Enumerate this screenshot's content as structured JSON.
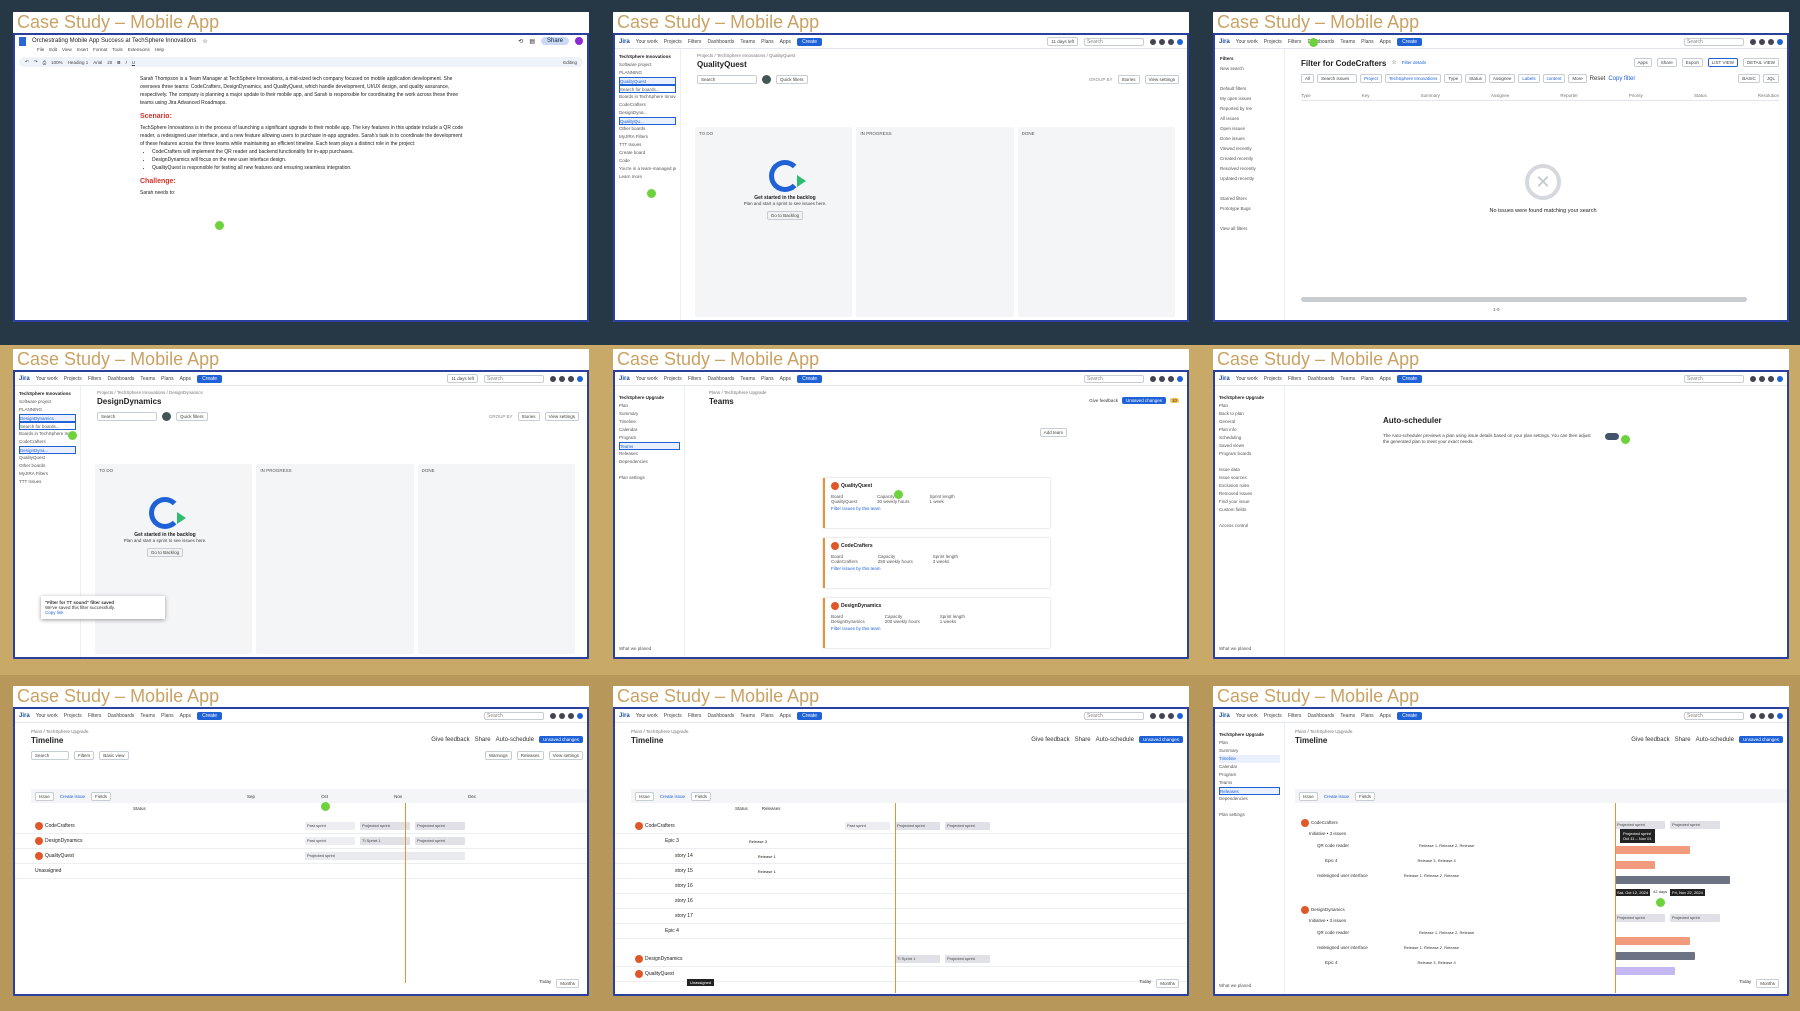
{
  "caption": "Case Study – Mobile App",
  "jira_nav": {
    "logo": "Jira",
    "items": [
      "Your work",
      "Projects",
      "Filters",
      "Dashboards",
      "Teams",
      "Plans",
      "Apps"
    ],
    "create": "Create",
    "search": "Search"
  },
  "doc": {
    "title": "Orchestrating Mobile App Success at TechSphere Innovations",
    "menu": [
      "File",
      "Edit",
      "View",
      "Insert",
      "Format",
      "Tools",
      "Extensions",
      "Help"
    ],
    "toolbar": [
      "100%",
      "Heading 1",
      "Arial",
      "20",
      "Editing"
    ],
    "share": "Share",
    "intro": "Sarah Thompson is a Team Manager at TechSphere Innovations, a mid-sized tech company focused on mobile application development. She oversees three teams: CodeCrafters, DesignDynamics, and QualityQuest, which handle development, UI/UX design, and quality assurance, respectively. The company is planning a major update to their mobile app, and Sarah is responsible for coordinating the work across these three teams using Jira Advanced Roadmaps.",
    "scenario_title": "Scenario:",
    "scenario": "TechSphere Innovations is in the process of launching a significant upgrade to their mobile app. The key features in this update include a QR code reader, a redesigned user interface, and a new feature allowing users to purchase in-app upgrades. Sarah's task is to coordinate the development of these features across the three teams while maintaining an efficient timeline. Each team plays a distinct role in the project:",
    "bullets": [
      "CodeCrafters will implement the QR reader and backend functionality for in-app purchases.",
      "DesignDynamics will focus on the new user interface design.",
      "QualityQuest is responsible for testing all new features and ensuring seamless integration."
    ],
    "challenge_title": "Challenge:",
    "challenge": "Sarah needs to:"
  },
  "board_qq": {
    "project": "TechSphere Innovations",
    "project_sub": "Software project",
    "planning": "PLANNING",
    "selected": "QualityQuest",
    "selected_sub": "Board",
    "search_boards": "Search for boards...",
    "boards_in": "Boards in TechSphere Innovations",
    "boards": [
      "CodeCrafters",
      "DesignDyna...",
      "QualityQu..."
    ],
    "other": "Other boards",
    "view_all": "View all",
    "other_boards": [
      "MyJIRA Filters",
      "TTT Issues"
    ],
    "create_board": "Create board",
    "code": "Code",
    "team_managed": "You're in a team-managed project",
    "learn": "Learn more",
    "crumbs": "Projects  /  TechSphere Innovations  /  QualityQuest",
    "title": "QualityQuest",
    "search": "Search",
    "quick": "Quick filters",
    "group": "GROUP BY",
    "stories": "Stories",
    "view_settings": "View settings",
    "start_standup": "Start stand-up",
    "days_left": "11 days left",
    "cols": [
      "TO DO",
      "IN PROGRESS",
      "DONE"
    ],
    "empty_title": "Get started in the backlog",
    "empty_text": "Plan and start a sprint to see issues here.",
    "go": "Go to Backlog"
  },
  "filter": {
    "side_title": "Filters",
    "side": [
      "New search",
      "",
      "Default filters",
      "My open issues",
      "Reported by me",
      "All issues",
      "Open issues",
      "Done issues",
      "Viewed recently",
      "Created recently",
      "Resolved recently",
      "Updated recently",
      "",
      "Starred filters",
      "Prototype Bugs",
      "",
      "View all filters"
    ],
    "title": "Filter for CodeCrafters",
    "filter_details": "Filter details",
    "apps": "Apps",
    "share": "Share",
    "export": "Export",
    "list_view": "LIST VIEW",
    "detail_view": "DETAIL VIEW",
    "all": "All",
    "search_issues": "Search issues",
    "chips": [
      "Project",
      "TechSphere Innovations",
      "Type",
      "Status",
      "Assignee",
      "Labels",
      "content",
      "More"
    ],
    "reset": "Reset",
    "copy": "Copy filter",
    "basic": "BASIC",
    "jql": "JQL",
    "cols": [
      "Type",
      "Key",
      "Summary",
      "Assignee",
      "Reporter",
      "Priority",
      "Status",
      "Resolution"
    ],
    "empty": "No issues were found matching your search",
    "pager": "1-0"
  },
  "board_dd": {
    "title": "DesignDynamics",
    "crumbs": "Projects  /  TechSphere Innovations  /  DesignDynamics",
    "selected": "DesignDynamics",
    "boards": [
      "CodeCrafters",
      "DesignDyna...",
      "QualityQuest"
    ],
    "toast_title": "\"Filter for TT sound\" filter saved",
    "toast_text": "We've saved this filter successfully.",
    "toast_link": "Copy link"
  },
  "teams": {
    "plan": "TechSphere Upgrade",
    "plan_sub": "Plan",
    "side": [
      "Summary",
      "Timeline",
      "Calendar",
      "Program",
      "Teams",
      "Releases",
      "Dependencies",
      "",
      "Plan settings"
    ],
    "beta": "BETA",
    "crumbs": "Plans  /  TechSphere Upgrade",
    "title": "Teams",
    "give_feedback": "Give feedback",
    "unsaved": "Unsaved changes",
    "unsaved_count": "10",
    "add_team": "Add team",
    "cards": [
      {
        "name": "QualityQuest",
        "board": "QualityQuest",
        "capacity": "30 weekly hours",
        "sprint": "1 week"
      },
      {
        "name": "CodeCrafters",
        "board": "CodeCrafters",
        "capacity": "250 weekly hours",
        "sprint": "3 weeks"
      },
      {
        "name": "DesignDynamics",
        "board": "DesignDynamics",
        "capacity": "200 weekly hours",
        "sprint": "1 weeks"
      }
    ],
    "board_lbl": "Board",
    "capacity_lbl": "Capacity",
    "sprint_lbl": "Sprint length",
    "filter_link": "Filter issues by this team",
    "footer": "What we planed"
  },
  "autosched": {
    "back": "Back to plan",
    "side": [
      "General",
      "Plan info",
      "Scheduling",
      "Saved views",
      "Program boards",
      "",
      "Issue data",
      "Issue sources",
      "Exclusion rules",
      "Removed issues",
      "Find your issue",
      "Custom fields",
      "",
      "Access control"
    ],
    "title": "Auto-scheduler",
    "text": "The Auto-scheduler previews a plan using issue details based on your plan settings. You can then adjust the generated plan to meet your exact needs."
  },
  "timeline": {
    "title": "Timeline",
    "auto": "Auto-schedule",
    "share": "Share",
    "filters": "Filters",
    "basic_view": "Basic view",
    "default": "default",
    "warnings": "Warnings",
    "releases": "Releases",
    "issue": "Issue",
    "create_issue": "Create issue",
    "fields": "Fields",
    "status": "Status",
    "rel_col": "Releases",
    "months": [
      "Sep",
      "Oct",
      "Nov",
      "Dec",
      "Jan"
    ],
    "rows": [
      "CodeCrafters",
      "DesignDynamics",
      "QualityQuest",
      "Unassigned"
    ],
    "today": "Today",
    "months_sel": "Months",
    "projected": "Projected sprint",
    "sprint1": "TI Sprint 1",
    "past": "Past sprint",
    "epic": "Epic 4",
    "story_rows": [
      "Epic 3",
      "story 14",
      "story 15",
      "story 16",
      "story 16",
      "story 17",
      "Epic 4"
    ],
    "release_vals": [
      "Release 3",
      "Release 1",
      "Release 1"
    ],
    "initiative": "Initiative • 3 issues",
    "t9_rows": [
      "QR code reader",
      "Epic 4",
      "redesigned user interface"
    ],
    "t9_rel": [
      "Release 1, Release 2, Release",
      "Release 3, Release 4",
      "Release 1, Release 2, Release"
    ],
    "tooltip": "Projected sprint",
    "tip_dates": "Oct 11 – Nov 01",
    "date_a": "Sat, Oct 12, 2024",
    "date_b": "42 days",
    "date_c": "Fri, Nov 22, 2024",
    "missing": "Unassigned"
  }
}
